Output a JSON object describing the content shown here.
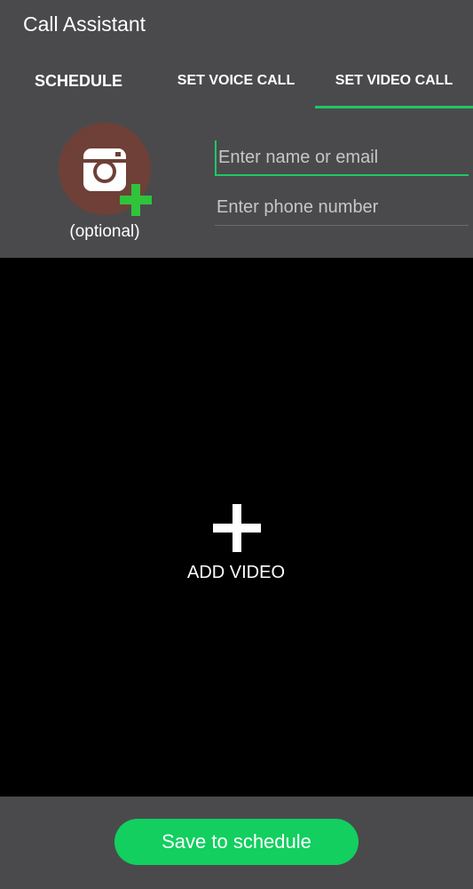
{
  "header": {
    "title": "Call Assistant"
  },
  "tabs": [
    {
      "label": "SCHEDULE",
      "selected": false
    },
    {
      "label": "SET VOICE CALL",
      "selected": false
    },
    {
      "label": "SET VIDEO CALL",
      "selected": true
    }
  ],
  "contact": {
    "photo_label": "(optional)",
    "photo_icon": "camera-icon",
    "add_icon": "plus-icon",
    "name_placeholder": "Enter name or email",
    "name_value": "",
    "phone_placeholder": "Enter phone number",
    "phone_value": ""
  },
  "video": {
    "add_label": "ADD VIDEO",
    "add_icon": "plus-icon"
  },
  "footer": {
    "save_label": "Save to schedule"
  },
  "colors": {
    "accent": "#1ec866",
    "button": "#12cf5f",
    "background": "#4a4a4c",
    "avatar": "#6e4037",
    "video_bg": "#000000"
  }
}
